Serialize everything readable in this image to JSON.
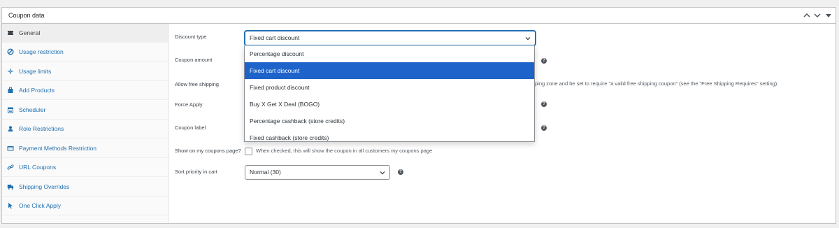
{
  "panel": {
    "title": "Coupon data",
    "collapse_up_icon": "chevron-up-icon",
    "collapse_down_icon": "chevron-down-icon",
    "toggle_icon": "caret-down-icon"
  },
  "sidebar": {
    "items": [
      {
        "label": "General",
        "icon": "ticket-icon",
        "active": true
      },
      {
        "label": "Usage restriction",
        "icon": "block-icon",
        "active": false
      },
      {
        "label": "Usage limits",
        "icon": "plus-sparkle-icon",
        "active": false
      },
      {
        "label": "Add Products",
        "icon": "bag-icon",
        "active": false
      },
      {
        "label": "Scheduler",
        "icon": "calendar-icon",
        "active": false
      },
      {
        "label": "Role Restrictions",
        "icon": "user-icon",
        "active": false
      },
      {
        "label": "Payment Methods Restriction",
        "icon": "card-icon",
        "active": false
      },
      {
        "label": "URL Coupons",
        "icon": "link-icon",
        "active": false
      },
      {
        "label": "Shipping Overrides",
        "icon": "truck-icon",
        "active": false
      },
      {
        "label": "One Click Apply",
        "icon": "pointer-icon",
        "active": false
      }
    ]
  },
  "form": {
    "discount_type": {
      "label": "Discount type",
      "value": "Fixed cart discount"
    },
    "coupon_amount": {
      "label": "Coupon amount"
    },
    "allow_free_shipping": {
      "label": "Allow free shipping",
      "description_visible": "ping zone and be set to require \"a valid free shipping coupon\" (see the \"Free Shipping Requires\" setting)."
    },
    "force_apply": {
      "label": "Force Apply"
    },
    "coupon_label": {
      "label": "Coupon label"
    },
    "show_on_my_coupons": {
      "label": "Show on my coupons page?",
      "description": "When checked, this will show the coupon in all customers my coupons page"
    },
    "sort_priority": {
      "label": "Sort priority in cart",
      "value": "Normal (30)"
    }
  },
  "dropdown": {
    "options": [
      {
        "label": "Percentage discount",
        "selected": false
      },
      {
        "label": "Fixed cart discount",
        "selected": true
      },
      {
        "label": "Fixed product discount",
        "selected": false
      },
      {
        "label": "Buy X Get X Deal (BOGO)",
        "selected": false
      },
      {
        "label": "Percentage cashback (store credits)",
        "selected": false
      },
      {
        "label": "Fixed cashback (store credits)",
        "selected": false
      }
    ]
  },
  "colors": {
    "accent": "#2271b1",
    "selected_option": "#1e63c9",
    "sidebar_bg": "#fafafa"
  }
}
